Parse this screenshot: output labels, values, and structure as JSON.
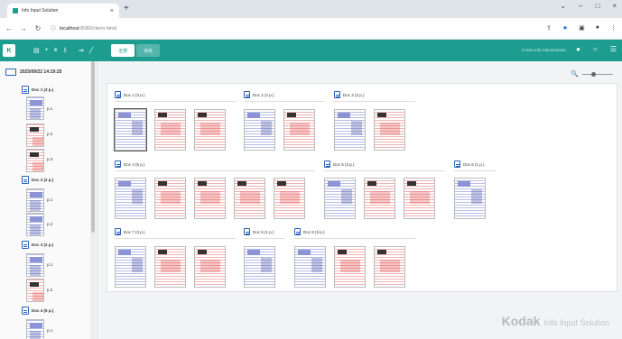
{
  "browser": {
    "tab_title": "Info Input Solution",
    "tab_close": "×",
    "new_tab": "+",
    "window_controls": [
      "⌄",
      "–",
      "□",
      "×"
    ],
    "url_host": "localhost",
    "url_path": ":8080/client-html/",
    "icons": [
      "back-icon",
      "forward-icon",
      "reload-icon",
      "site-info-icon",
      "share-icon",
      "star-icon",
      "extensions-icon",
      "profile-icon",
      "menu-icon"
    ]
  },
  "app": {
    "logo": "K",
    "tabs": [
      "全部",
      "待处"
    ],
    "user": "KAMA Info Administrator",
    "accent": "#1d9d8f"
  },
  "sidebar": {
    "batch": "2025/09/22 14:19:25",
    "docs": [
      {
        "label": "Doc 1 (3 p.)",
        "pages": [
          "p.1",
          "p.2",
          "p.3"
        ]
      },
      {
        "label": "Doc 2 (2 p.)",
        "pages": [
          "p.1",
          "p.2"
        ]
      },
      {
        "label": "Doc 3 (2 p.)",
        "pages": [
          "p.1",
          "p.2"
        ]
      },
      {
        "label": "Doc 4 (5 p.)",
        "pages": [
          "p.1"
        ]
      }
    ]
  },
  "main": {
    "docs": [
      {
        "label": "Doc 1 (3 p.)"
      },
      {
        "label": "Doc 2 (2 p.)"
      },
      {
        "label": "Doc 3 (2 p.)"
      },
      {
        "label": "Doc 4 (5 p.)"
      },
      {
        "label": "Doc 5 (3 p.)"
      },
      {
        "label": "Doc 6 (1 p.)"
      },
      {
        "label": "Doc 7 (3 p.)"
      },
      {
        "label": "Doc 8 (1 p.)"
      },
      {
        "label": "Doc 9 (3 p.)"
      }
    ],
    "zoom_icon": "🔍"
  },
  "brand": {
    "name": "Kodak",
    "product": "Info Input Solution"
  }
}
